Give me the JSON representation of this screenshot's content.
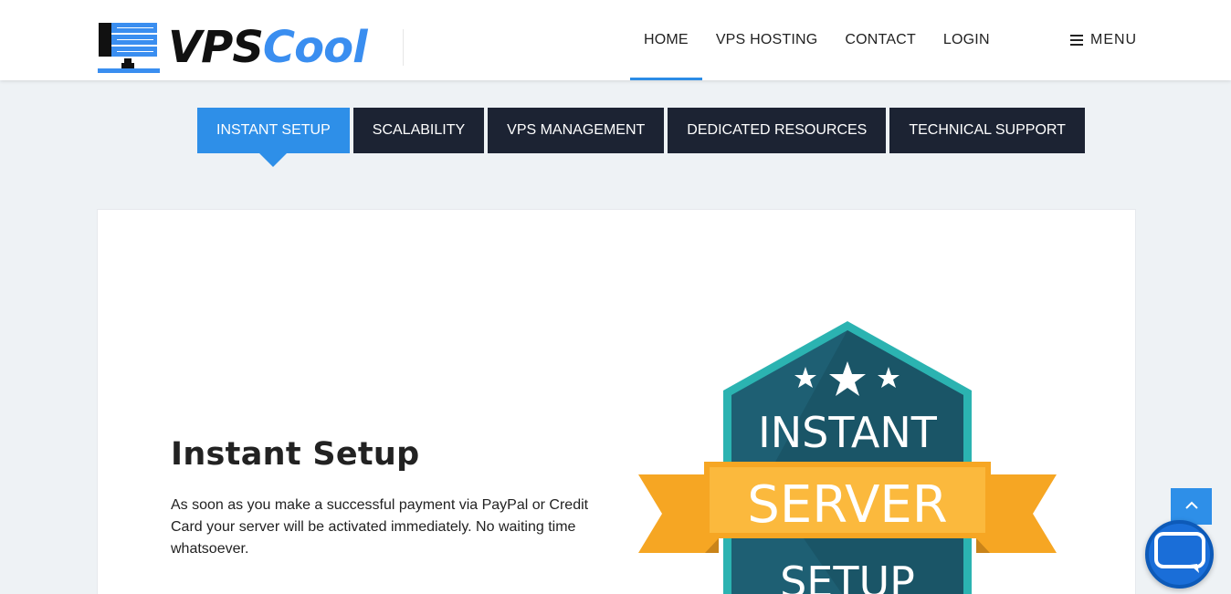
{
  "brand": {
    "logo_part1": "VPS",
    "logo_part2": "Cool"
  },
  "nav": {
    "items": [
      {
        "label": "HOME",
        "active": true
      },
      {
        "label": "VPS HOSTING",
        "active": false
      },
      {
        "label": "CONTACT",
        "active": false
      },
      {
        "label": "LOGIN",
        "active": false
      }
    ],
    "menu_label": "MENU"
  },
  "tabs": [
    {
      "label": "INSTANT SETUP",
      "active": true
    },
    {
      "label": "SCALABILITY",
      "active": false
    },
    {
      "label": "VPS MANAGEMENT",
      "active": false
    },
    {
      "label": "DEDICATED RESOURCES",
      "active": false
    },
    {
      "label": "TECHNICAL SUPPORT",
      "active": false
    }
  ],
  "content": {
    "title": "Instant Setup",
    "text": "As soon as you make a successful payment via PayPal or Credit Card your server will be activated immediately. No waiting time whatsoever."
  },
  "badge": {
    "line1": "INSTANT",
    "line2": "SERVER",
    "line3": "SETUP"
  },
  "colors": {
    "accent": "#2e8fe8",
    "tab_dark": "#1c2333",
    "badge_teal": "#1e5f73",
    "badge_border": "#2bb3b1",
    "ribbon": "#f6a623"
  },
  "icons": {
    "menu": "hamburger-icon",
    "scroll_top": "chevron-up-icon",
    "chat": "chat-bubble-icon",
    "logo": "server-rack-icon"
  }
}
